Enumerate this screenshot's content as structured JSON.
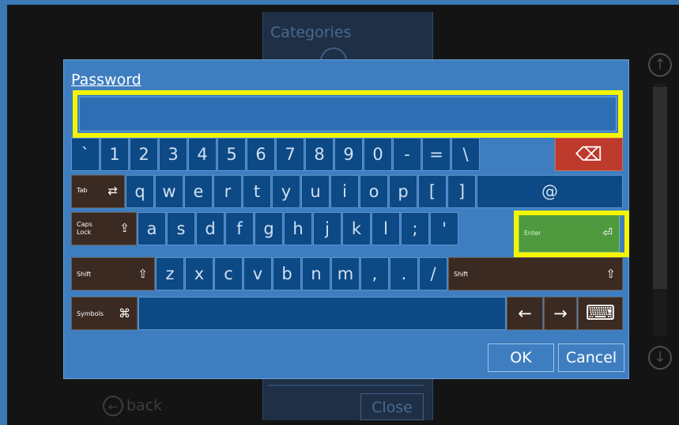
{
  "background": {
    "panel_title": "Categories",
    "back_label": "back",
    "close_label": "Close",
    "scroll_up_glyph": "↑",
    "scroll_down_glyph": "↓",
    "back_glyph": "←"
  },
  "dialog": {
    "title": "Password",
    "input_value": "",
    "ok_label": "OK",
    "cancel_label": "Cancel"
  },
  "keyboard": {
    "row1": [
      "`",
      "1",
      "2",
      "3",
      "4",
      "5",
      "6",
      "7",
      "8",
      "9",
      "0",
      "-",
      "=",
      "\\"
    ],
    "backspace_glyph": "⌫",
    "tab_label": "Tab",
    "tab_glyph": "⇄",
    "row2": [
      "q",
      "w",
      "e",
      "r",
      "t",
      "y",
      "u",
      "i",
      "o",
      "p",
      "[",
      "]"
    ],
    "at_key": "@",
    "caps_label_1": "Caps",
    "caps_label_2": "Lock",
    "caps_glyph": "⇪",
    "row3": [
      "a",
      "s",
      "d",
      "f",
      "g",
      "h",
      "j",
      "k",
      "l",
      ";",
      "'"
    ],
    "enter_label": "Enter",
    "enter_glyph": "⏎",
    "shift_label": "Shift",
    "shift_glyph": "⇧",
    "row4": [
      "z",
      "x",
      "c",
      "v",
      "b",
      "n",
      "m",
      ",",
      ".",
      "/"
    ],
    "symbols_label": "Symbols",
    "symbols_glyph": "⌘",
    "left_arrow": "←",
    "right_arrow": "→",
    "hide_keyboard_glyph": "⌨"
  },
  "colors": {
    "dialog_bg": "#3e7ec0",
    "key_bg": "#0d4985",
    "modifier_bg": "#3b2a22",
    "backspace_bg": "#bd3a2c",
    "enter_bg": "#4f9a3f",
    "highlight": "#f5f500"
  }
}
